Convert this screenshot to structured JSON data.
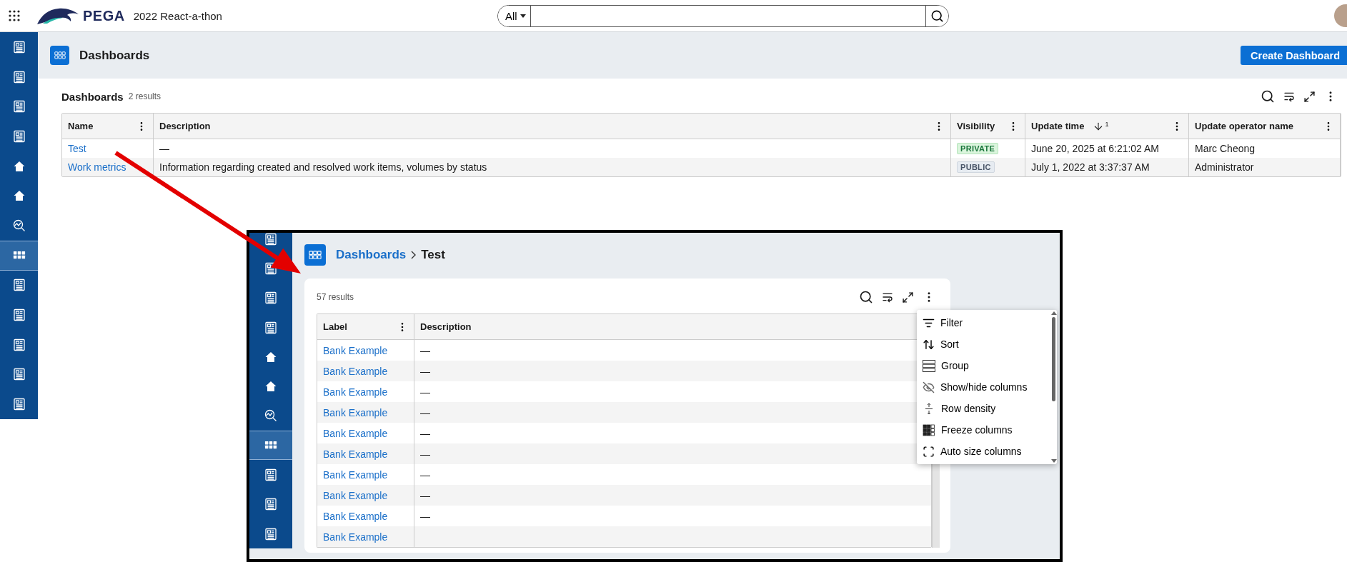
{
  "app_bar": {
    "brand": "PEGA",
    "title": "2022 React-a-thon",
    "search": {
      "scope": "All"
    }
  },
  "sidebar": {
    "items": [
      {
        "kind": "doc",
        "selected": false
      },
      {
        "kind": "doc",
        "selected": false
      },
      {
        "kind": "doc",
        "selected": false
      },
      {
        "kind": "doc",
        "selected": false
      },
      {
        "kind": "home",
        "selected": false
      },
      {
        "kind": "home",
        "selected": false
      },
      {
        "kind": "analytics",
        "selected": false
      },
      {
        "kind": "grid",
        "selected": true
      },
      {
        "kind": "doc",
        "selected": false
      },
      {
        "kind": "doc",
        "selected": false
      },
      {
        "kind": "doc",
        "selected": false
      },
      {
        "kind": "doc",
        "selected": false
      },
      {
        "kind": "doc",
        "selected": false
      }
    ]
  },
  "page": {
    "title": "Dashboards",
    "create_button": "Create Dashboard"
  },
  "list": {
    "title": "Dashboards",
    "count": "2 results",
    "columns": [
      {
        "label": "Name"
      },
      {
        "label": "Description"
      },
      {
        "label": "Visibility"
      },
      {
        "label": "Update time",
        "sort_rank": "1"
      },
      {
        "label": "Update operator name"
      }
    ],
    "rows": [
      {
        "name": "Test",
        "description": "—",
        "visibility": {
          "label": "PRIVATE",
          "kind": "private"
        },
        "update_time": "June 20, 2025 at 6:21:02 AM",
        "operator": "Marc Cheong"
      },
      {
        "name": "Work metrics",
        "description": "Information regarding created and resolved work items, volumes by status",
        "visibility": {
          "label": "PUBLIC",
          "kind": "public"
        },
        "update_time": "July 1, 2022 at 3:37:37 AM",
        "operator": "Administrator"
      }
    ]
  },
  "inset": {
    "sidebar": {
      "items": [
        {
          "kind": "doc",
          "selected": false
        },
        {
          "kind": "doc",
          "selected": false
        },
        {
          "kind": "doc",
          "selected": false
        },
        {
          "kind": "doc",
          "selected": false
        },
        {
          "kind": "home",
          "selected": false
        },
        {
          "kind": "home",
          "selected": false
        },
        {
          "kind": "analytics",
          "selected": false
        },
        {
          "kind": "grid",
          "selected": true
        },
        {
          "kind": "doc",
          "selected": false
        },
        {
          "kind": "doc",
          "selected": false
        },
        {
          "kind": "doc",
          "selected": false
        }
      ]
    },
    "breadcrumb": {
      "parent": "Dashboards",
      "current": "Test"
    },
    "count": "57 results",
    "columns": [
      {
        "label": "Label"
      },
      {
        "label": "Description"
      }
    ],
    "rows": [
      {
        "label": "Bank Example",
        "description": "—"
      },
      {
        "label": "Bank Example",
        "description": "—"
      },
      {
        "label": "Bank Example",
        "description": "—"
      },
      {
        "label": "Bank Example",
        "description": "—"
      },
      {
        "label": "Bank Example",
        "description": "—"
      },
      {
        "label": "Bank Example",
        "description": "—"
      },
      {
        "label": "Bank Example",
        "description": "—"
      },
      {
        "label": "Bank Example",
        "description": "—"
      },
      {
        "label": "Bank Example",
        "description": "—"
      },
      {
        "label": "Bank Example"
      }
    ],
    "menu": {
      "items": [
        {
          "kind": "filter",
          "label": "Filter"
        },
        {
          "kind": "sort",
          "label": "Sort"
        },
        {
          "kind": "group",
          "label": "Group"
        },
        {
          "kind": "visibility",
          "label": "Show/hide columns"
        },
        {
          "kind": "density",
          "label": "Row density"
        },
        {
          "kind": "freeze",
          "label": "Freeze columns"
        },
        {
          "kind": "autosize",
          "label": "Auto size columns"
        }
      ]
    }
  }
}
